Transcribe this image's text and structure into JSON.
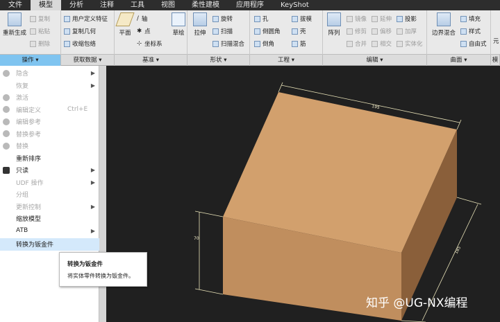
{
  "tabs": [
    "文件",
    "模型",
    "分析",
    "注释",
    "工具",
    "视图",
    "柔性建模",
    "应用程序",
    "KeyShot"
  ],
  "active_tab": "模型",
  "ribbon": {
    "regen": "重新生成",
    "copy": "复制",
    "paste": "粘贴",
    "delete": "删除",
    "udf": "用户定义特征",
    "copy_geom": "复制几何",
    "shrinkwrap": "收缩包络",
    "plane": "平面",
    "axis": "轴",
    "point": "点",
    "csys": "坐标系",
    "sketch": "草绘",
    "extrude": "拉伸",
    "revolve": "旋转",
    "sweep": "扫描",
    "swept_blend": "扫描混合",
    "hole": "孔",
    "round": "倒圆角",
    "chamfer": "倒角",
    "draft": "拔模",
    "shell": "壳",
    "rib": "筋",
    "pattern": "阵列",
    "mirror": "镜像",
    "extend": "延伸",
    "project": "投影",
    "trim": "修剪",
    "offset": "偏移",
    "thicken": "加厚",
    "merge": "合并",
    "intersect": "相交",
    "solidify": "实体化",
    "boundary_blend": "边界混合",
    "fill": "填充",
    "style": "样式",
    "freestyle": "自由式",
    "cut_label": "元"
  },
  "group_labels": [
    "操作",
    "获取数据",
    "基准",
    "形状",
    "工程",
    "编辑",
    "曲面",
    "模"
  ],
  "menu": [
    {
      "label": "隐含",
      "disabled": true,
      "arrow": true
    },
    {
      "label": "恢复",
      "disabled": true,
      "arrow": true
    },
    {
      "label": "激活",
      "disabled": true,
      "arrow": false
    },
    {
      "label": "编辑定义",
      "disabled": true,
      "arrow": false,
      "shortcut": "Ctrl+E"
    },
    {
      "label": "编辑参考",
      "disabled": true,
      "arrow": false
    },
    {
      "label": "替换参考",
      "disabled": true,
      "arrow": false
    },
    {
      "label": "替换",
      "disabled": true,
      "arrow": false
    },
    {
      "label": "重新排序",
      "disabled": false,
      "arrow": false
    },
    {
      "label": "只读",
      "disabled": false,
      "arrow": true
    },
    {
      "label": "UDF 操作",
      "disabled": true,
      "arrow": true
    },
    {
      "label": "分组",
      "disabled": true,
      "arrow": false
    },
    {
      "label": "更新控制",
      "disabled": true,
      "arrow": true
    },
    {
      "label": "缩放模型",
      "disabled": false,
      "arrow": false
    },
    {
      "label": "ATB",
      "disabled": false,
      "arrow": true
    },
    {
      "label": "转换为钣金件",
      "disabled": false,
      "arrow": false,
      "highlight": true
    }
  ],
  "tooltip": {
    "title": "转换为钣金件",
    "desc": "将实体零件转换为钣金件。"
  },
  "model": {
    "dim_width": "195",
    "dim_depth": "185",
    "dim_height": "70"
  },
  "watermark": "知乎 @UG-NX编程",
  "colors": {
    "accent": "#7fc4f0",
    "viewport": "#202020",
    "block_top": "#d4a06b",
    "block_front": "#c28e5c",
    "block_side": "#8e6137"
  }
}
